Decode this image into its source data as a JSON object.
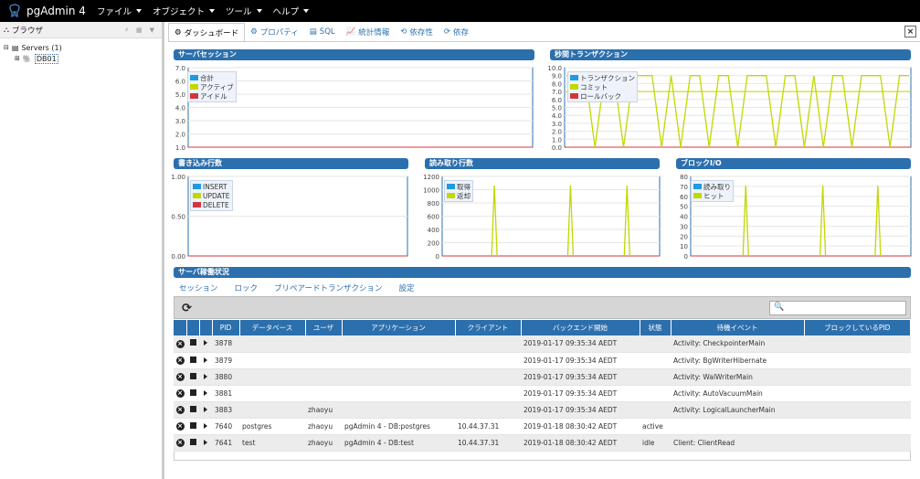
{
  "app": {
    "title": "pgAdmin 4"
  },
  "menu": [
    {
      "label": "ファイル"
    },
    {
      "label": "オブジェクト"
    },
    {
      "label": "ツール"
    },
    {
      "label": "ヘルプ"
    }
  ],
  "browser": {
    "title": "ブラウザ",
    "tree": [
      {
        "label": "Servers (1)"
      },
      {
        "label": "DB01"
      }
    ]
  },
  "tabs": [
    {
      "label": "ダッシュボード"
    },
    {
      "label": "プロパティ"
    },
    {
      "label": "SQL"
    },
    {
      "label": "統計情報"
    },
    {
      "label": "依存性"
    },
    {
      "label": "依存"
    }
  ],
  "panels": {
    "sessions": "サーバセッション",
    "tps": "秒間トランザクション",
    "tuples_in": "書き込み行数",
    "tuples_out": "読み取り行数",
    "block_io": "ブロックI/O",
    "activity": "サーバ稼働状況"
  },
  "chart_data": [
    {
      "type": "line",
      "y_ticks": [
        "7.0",
        "6.0",
        "5.0",
        "4.0",
        "3.0",
        "2.0",
        "1.0"
      ],
      "ylim": [
        1,
        7
      ],
      "series": [
        {
          "name": "合計",
          "color": "#1f9be0"
        },
        {
          "name": "アクティブ",
          "color": "#c0d800"
        },
        {
          "name": "アイドル",
          "color": "#d4343c"
        }
      ]
    },
    {
      "type": "line",
      "y_ticks": [
        "10.0",
        "9.0",
        "8.0",
        "7.0",
        "6.0",
        "5.0",
        "4.0",
        "3.0",
        "2.0",
        "1.0",
        "0.0"
      ],
      "ylim": [
        0,
        10
      ],
      "series": [
        {
          "name": "トランザクション",
          "color": "#1f9be0"
        },
        {
          "name": "コミット",
          "color": "#c0d800"
        },
        {
          "name": "ロールバック",
          "color": "#d4343c"
        }
      ]
    },
    {
      "type": "line",
      "y_ticks": [
        "1.00",
        "0.50",
        "0.00"
      ],
      "ylim": [
        0,
        1
      ],
      "series": [
        {
          "name": "INSERT",
          "color": "#1f9be0"
        },
        {
          "name": "UPDATE",
          "color": "#c0d800"
        },
        {
          "name": "DELETE",
          "color": "#d4343c"
        }
      ]
    },
    {
      "type": "line",
      "y_ticks": [
        "1200",
        "1000",
        "800",
        "600",
        "400",
        "200",
        "0"
      ],
      "ylim": [
        0,
        1200
      ],
      "series": [
        {
          "name": "取得",
          "color": "#1f9be0"
        },
        {
          "name": "返却",
          "color": "#c0d800"
        }
      ]
    },
    {
      "type": "line",
      "y_ticks": [
        "80",
        "70",
        "60",
        "50",
        "40",
        "30",
        "20",
        "10",
        "0"
      ],
      "ylim": [
        0,
        80
      ],
      "series": [
        {
          "name": "読み取り",
          "color": "#1f9be0"
        },
        {
          "name": "ヒット",
          "color": "#c0d800"
        }
      ]
    }
  ],
  "status": {
    "tabs": [
      {
        "label": "セッション"
      },
      {
        "label": "ロック"
      },
      {
        "label": "プリペアードトランザクション"
      },
      {
        "label": "設定"
      }
    ],
    "columns": [
      "PID",
      "データベース",
      "ユーザ",
      "アプリケーション",
      "クライアント",
      "バックエンド開始",
      "状態",
      "待機イベント",
      "ブロックしているPID"
    ],
    "rows": [
      [
        "3878",
        "",
        "",
        "",
        "",
        "2019-01-17 09:35:34 AEDT",
        "",
        "Activity: CheckpointerMain",
        ""
      ],
      [
        "3879",
        "",
        "",
        "",
        "",
        "2019-01-17 09:35:34 AEDT",
        "",
        "Activity: BgWriterHibernate",
        ""
      ],
      [
        "3880",
        "",
        "",
        "",
        "",
        "2019-01-17 09:35:34 AEDT",
        "",
        "Activity: WalWriterMain",
        ""
      ],
      [
        "3881",
        "",
        "",
        "",
        "",
        "2019-01-17 09:35:34 AEDT",
        "",
        "Activity: AutoVacuumMain",
        ""
      ],
      [
        "3883",
        "",
        "zhaoyu",
        "",
        "",
        "2019-01-17 09:35:34 AEDT",
        "",
        "Activity: LogicalLauncherMain",
        ""
      ],
      [
        "7640",
        "postgres",
        "zhaoyu",
        "pgAdmin 4 - DB:postgres",
        "10.44.37.31",
        "2019-01-18 08:30:42 AEDT",
        "active",
        "",
        ""
      ],
      [
        "7641",
        "test",
        "zhaoyu",
        "pgAdmin 4 - DB:test",
        "10.44.37.31",
        "2019-01-18 08:30:42 AEDT",
        "idle",
        "Client: ClientRead",
        ""
      ]
    ]
  }
}
